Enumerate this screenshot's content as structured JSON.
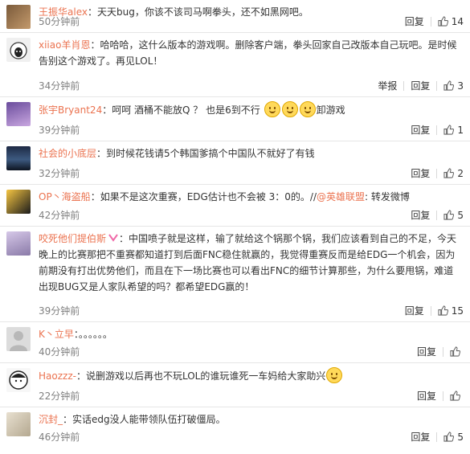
{
  "actions": {
    "reply": "回复",
    "report": "举报"
  },
  "comments": [
    {
      "user": "王振华alex",
      "content": "天天bug，你该不该司马啊拳头，还不如黑网吧。",
      "time": "50分钟前",
      "likes": "14"
    },
    {
      "user": "xiiao羊肖恩",
      "content": "哈哈哈，这什么版本的游戏啊。删除客户端，拳头回家自己改版本自己玩吧。是时候告别这个游戏了。再见LOL！",
      "time": "34分钟前",
      "likes": "3"
    },
    {
      "user": "张宇Bryant24",
      "content": "呵呵 酒桶不能放Q ？ 也是6到不行",
      "content_tail": "卸游戏",
      "time": "39分钟前",
      "likes": "1"
    },
    {
      "user": "社会的小底层",
      "content": "到时候花钱请5个韩国爹搞个中国队不就好了有钱",
      "time": "32分钟前",
      "likes": "2"
    },
    {
      "user": "OP丶海盗船",
      "content": "如果不是这次重赛，EDG估计也不会被 3：0的。//",
      "mention": "@英雄联盟",
      "content_tail": ": 转发微博",
      "time": "42分钟前",
      "likes": "5"
    },
    {
      "user": "咬死他们提伯斯",
      "content": "中国喷子就是这样，输了就给这个锅那个锅，我们应该看到自己的不足，今天晚上的比赛那把不重赛都知道打到后面FNC稳住就赢的，我觉得重赛反而是给EDG一个机会，因为前期没有打出优势他们，而且在下一场比赛也可以看出FNC的细节计算那些，为什么要甩锅，难道出现BUG又是人家队希望的吗？都希望EDG赢的！",
      "time": "39分钟前",
      "likes": "15"
    },
    {
      "user": "K丶立早",
      "content": "。。。。。。",
      "time": "40分钟前",
      "likes": ""
    },
    {
      "user": "Haozzz-",
      "content": "说删游戏以后再也不玩LOL的谁玩谁死一车妈给大家助兴",
      "time": "22分钟前",
      "likes": ""
    },
    {
      "user": "沉封_",
      "content": "实话edg没人能带领队伍打破僵局。",
      "time": "46分钟前",
      "likes": "5"
    }
  ]
}
